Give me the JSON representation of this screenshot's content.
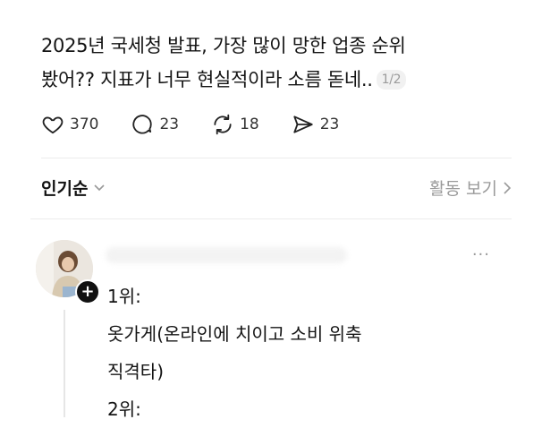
{
  "post": {
    "line1": "2025년 국세청 발표, 가장 많이 망한 업종 순위",
    "line2": "봤어?? 지표가 너무 현실적이라 소름 돋네..",
    "page_indicator": "1/2"
  },
  "actions": {
    "likes": "370",
    "comments": "23",
    "reposts": "18",
    "shares": "23"
  },
  "sort": {
    "label": "인기순"
  },
  "activity": {
    "label": "활동 보기"
  },
  "comment": {
    "more": "···",
    "follow": "+",
    "lines": [
      "1위:",
      "옷가게(온라인에 치이고 소비 위축",
      "직격타)",
      "2위:"
    ]
  },
  "colors": {
    "text": "#141414",
    "muted": "#9a9a9a",
    "divider": "#ececec"
  }
}
